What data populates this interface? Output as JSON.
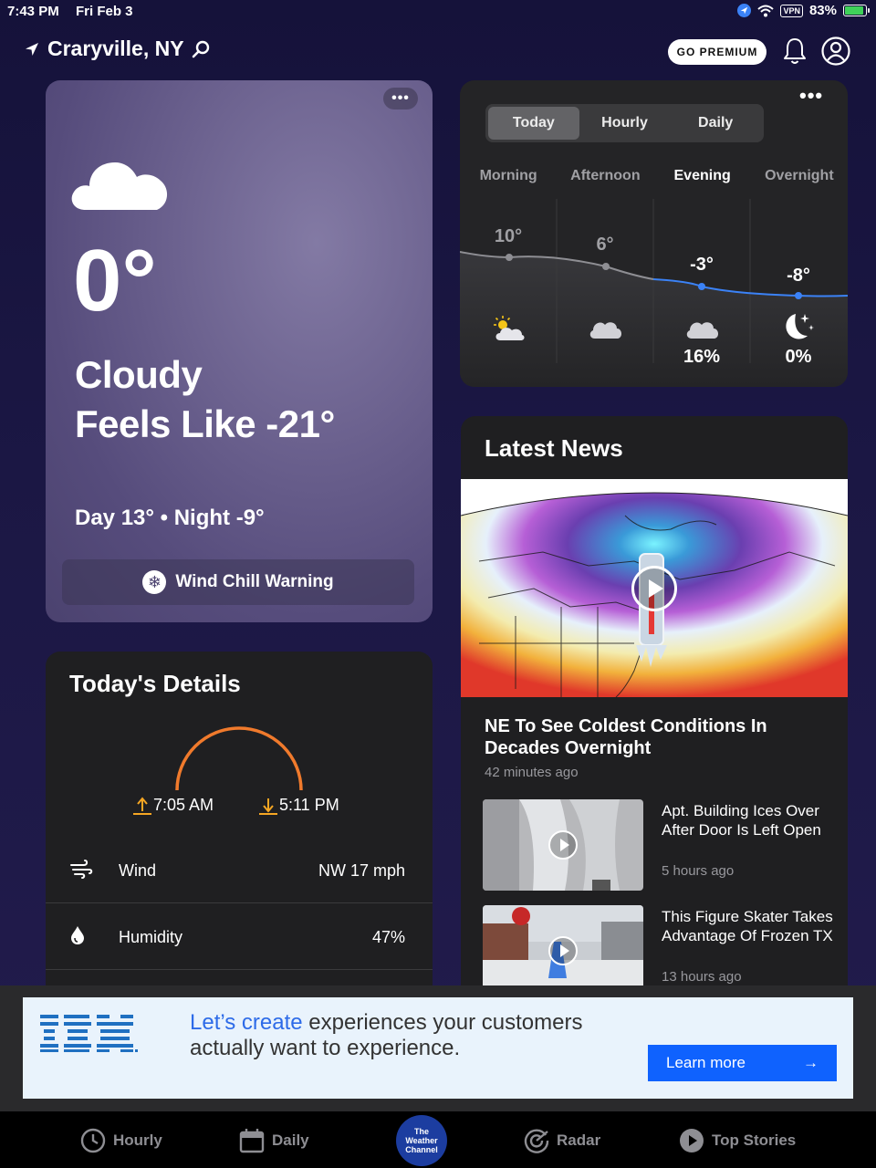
{
  "status_bar": {
    "time": "7:43 PM",
    "date": "Fri Feb 3",
    "vpn": "VPN",
    "battery": "83%",
    "battery_level": 0.83
  },
  "header": {
    "location": "Craryville, NY",
    "premium_label": "GO PREMIUM"
  },
  "current": {
    "temperature": "0°",
    "condition": "Cloudy",
    "feels_like": "Feels Like -21°",
    "day_night": "Day 13° • Night -9°",
    "warning": "Wind Chill Warning",
    "icon": "cloud-icon"
  },
  "forecast": {
    "tabs": [
      "Today",
      "Hourly",
      "Daily"
    ],
    "active_tab": "Today",
    "periods": [
      {
        "label": "Morning",
        "temp": "10°",
        "icon": "partly-sunny-icon",
        "precip": ""
      },
      {
        "label": "Afternoon",
        "temp": "6°",
        "icon": "cloud-icon",
        "precip": ""
      },
      {
        "label": "Evening",
        "temp": "-3°",
        "icon": "cloud-icon",
        "precip": "16%"
      },
      {
        "label": "Overnight",
        "temp": "-8°",
        "icon": "moon-stars-icon",
        "precip": "0%"
      }
    ],
    "active_period": "Evening",
    "colors": {
      "past_line": "#8e8e93",
      "future_line": "#3b82f6"
    }
  },
  "details": {
    "title": "Today's Details",
    "sunrise": "7:05 AM",
    "sunset": "5:11 PM",
    "rows": [
      {
        "label": "Wind",
        "value": "NW 17 mph",
        "icon": "wind-icon"
      },
      {
        "label": "Humidity",
        "value": "47%",
        "icon": "humidity-drop-icon"
      }
    ],
    "arc_color": "#f07a2c"
  },
  "news": {
    "title": "Latest News",
    "hero": {
      "title": "NE To See Coldest Conditions In Decades Overnight",
      "time": "42 minutes ago"
    },
    "stories": [
      {
        "title": "Apt. Building Ices Over After Door Is Left Open",
        "time": "5 hours ago"
      },
      {
        "title": "This Figure Skater Takes Advantage Of Frozen TX",
        "time": "13 hours ago"
      }
    ]
  },
  "ad": {
    "brand": "IBM",
    "headline_highlight": "Let’s create",
    "headline_rest": " experiences your customers actually want to experience.",
    "cta": "Learn more",
    "cta_arrow": "→",
    "accent": "#0f62fe"
  },
  "tabbar": {
    "items": [
      {
        "label": "Hourly",
        "icon": "clock-icon"
      },
      {
        "label": "Daily",
        "icon": "calendar-icon"
      },
      {
        "label": "Radar",
        "icon": "radar-icon"
      },
      {
        "label": "Top Stories",
        "icon": "play-circle-icon"
      }
    ],
    "center_logo": [
      "The",
      "Weather",
      "Channel"
    ]
  }
}
